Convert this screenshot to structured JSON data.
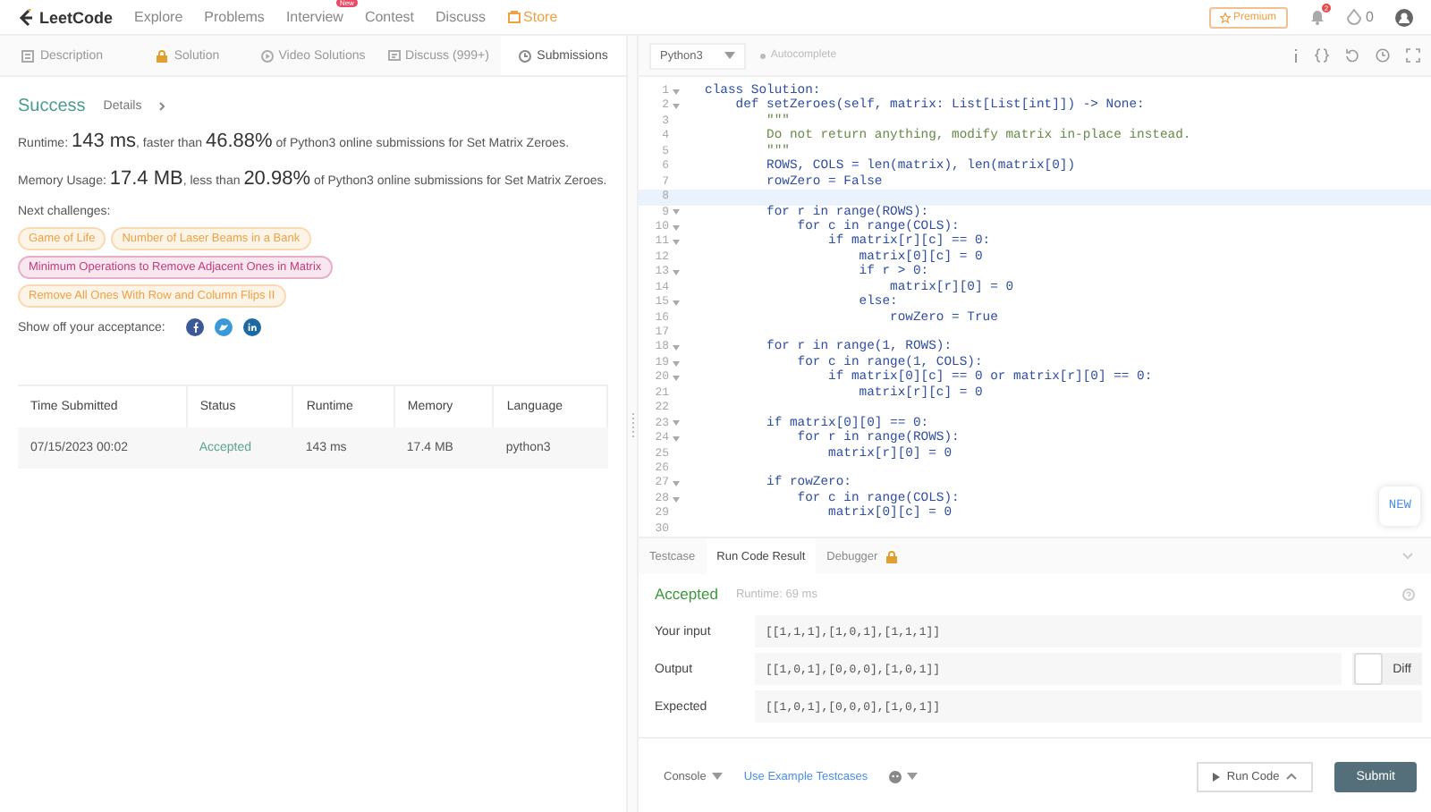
{
  "nav": {
    "brand": "LeetCode",
    "links": [
      {
        "label": "Explore"
      },
      {
        "label": "Problems"
      },
      {
        "label": "Interview",
        "badge": "New"
      },
      {
        "label": "Contest"
      },
      {
        "label": "Discuss"
      }
    ],
    "store": "Store",
    "premium": "Premium",
    "notifications": "2",
    "coins": "0"
  },
  "tabs": [
    {
      "label": "Description",
      "selected": false
    },
    {
      "label": "Solution",
      "selected": false
    },
    {
      "label": "Video Solutions",
      "selected": false
    },
    {
      "label": "Discuss (999+)",
      "selected": false
    },
    {
      "label": "Submissions",
      "selected": true
    }
  ],
  "result": {
    "status": "Success",
    "details": "Details",
    "runtime_line": "Runtime: **143 ms**, faster than **46.88%** of Python3 online submissions for Set Matrix Zeroes.",
    "memory_line": "Memory Usage: **17.4 MB**, less than **20.98%** of Python3 online submissions for Set Matrix Zeroes.",
    "next_label": "Next challenges:",
    "challenges": [
      {
        "label": "Game of Life",
        "color": "#f0a143"
      },
      {
        "label": "Number of Laser Beams in a Bank",
        "color": "#f0a143"
      },
      {
        "label": "Minimum Operations to Remove Adjacent Ones in Matrix",
        "color": "#c43b7c"
      },
      {
        "label": "Remove All Ones With Row and Column Flips II",
        "color": "#f0a143"
      }
    ],
    "share_label": "Show off your acceptance:"
  },
  "table": {
    "columns": [
      "Time Submitted",
      "Status",
      "Runtime",
      "Memory",
      "Language"
    ],
    "rows": [
      [
        "07/15/2023 00:02",
        "Accepted",
        "143 ms",
        "17.4 MB",
        "python3"
      ]
    ]
  },
  "editor": {
    "language": "Python3",
    "autocomplete": "Autocomplete",
    "lines": [
      {
        "num": "1",
        "text": "class Solution:",
        "kind": "code",
        "fold": true,
        "current": false
      },
      {
        "num": "2",
        "text": "    def setZeroes(self, matrix: List[List[int]]) -> None:",
        "kind": "code",
        "fold": true,
        "current": false
      },
      {
        "num": "3",
        "text": "        \"\"\"",
        "kind": "comment",
        "fold": false,
        "current": false
      },
      {
        "num": "4",
        "text": "        Do not return anything, modify matrix in-place instead.",
        "kind": "comment",
        "fold": false,
        "current": false
      },
      {
        "num": "5",
        "text": "        \"\"\"",
        "kind": "comment",
        "fold": false,
        "current": false
      },
      {
        "num": "6",
        "text": "        ROWS, COLS = len(matrix), len(matrix[0])",
        "kind": "code",
        "fold": false,
        "current": false
      },
      {
        "num": "7",
        "text": "        rowZero = False",
        "kind": "code",
        "fold": false,
        "current": false
      },
      {
        "num": "8",
        "fold": false,
        "current": true
      },
      {
        "num": "9",
        "text": "        for r in range(ROWS):",
        "kind": "code",
        "fold": true,
        "current": false
      },
      {
        "num": "10",
        "text": "            for c in range(COLS):",
        "kind": "code",
        "fold": true,
        "current": false
      },
      {
        "num": "11",
        "text": "                if matrix[r][c] == 0:",
        "kind": "code",
        "fold": true,
        "current": false
      },
      {
        "num": "12",
        "text": "                    matrix[0][c] = 0",
        "kind": "code",
        "fold": false,
        "current": false
      },
      {
        "num": "13",
        "text": "                    if r > 0:",
        "kind": "code",
        "fold": true,
        "current": false
      },
      {
        "num": "14",
        "text": "                        matrix[r][0] = 0",
        "kind": "code",
        "fold": false,
        "current": false
      },
      {
        "num": "15",
        "text": "                    else:",
        "kind": "code",
        "fold": true,
        "current": false
      },
      {
        "num": "16",
        "text": "                        rowZero = True",
        "kind": "code",
        "fold": false,
        "current": false
      },
      {
        "num": "17",
        "fold": false,
        "current": false
      },
      {
        "num": "18",
        "text": "        for r in range(1, ROWS):",
        "kind": "code",
        "fold": true,
        "current": false
      },
      {
        "num": "19",
        "text": "            for c in range(1, COLS):",
        "kind": "code",
        "fold": true,
        "current": false
      },
      {
        "num": "20",
        "text": "                if matrix[0][c] == 0 or matrix[r][0] == 0:",
        "kind": "code",
        "fold": true,
        "current": false
      },
      {
        "num": "21",
        "text": "                    matrix[r][c] = 0",
        "kind": "code",
        "fold": false,
        "current": false
      },
      {
        "num": "22",
        "fold": false,
        "current": false
      },
      {
        "num": "23",
        "text": "        if matrix[0][0] == 0:",
        "kind": "code",
        "fold": true,
        "current": false
      },
      {
        "num": "24",
        "text": "            for r in range(ROWS):",
        "kind": "code",
        "fold": true,
        "current": false
      },
      {
        "num": "25",
        "text": "                matrix[r][0] = 0",
        "kind": "code",
        "fold": false,
        "current": false
      },
      {
        "num": "26",
        "fold": false,
        "current": false
      },
      {
        "num": "27",
        "text": "        if rowZero:",
        "kind": "code",
        "fold": true,
        "current": false
      },
      {
        "num": "28",
        "text": "            for c in range(COLS):",
        "kind": "code",
        "fold": true,
        "current": false
      },
      {
        "num": "29",
        "text": "                matrix[0][c] = 0",
        "kind": "code",
        "fold": false,
        "current": false
      },
      {
        "num": "30",
        "fold": false,
        "current": false
      }
    ],
    "new_button": "NEW"
  },
  "console": {
    "tabs": [
      {
        "label": "Testcase",
        "selected": false,
        "locked": false
      },
      {
        "label": "Run Code Result",
        "selected": true,
        "locked": false
      },
      {
        "label": "Debugger",
        "selected": false,
        "locked": true
      }
    ],
    "status": "Accepted",
    "runtime": "Runtime: 69 ms",
    "rows": [
      {
        "label": "Your input",
        "value": "[[1,1,1],[1,0,1],[1,1,1]]",
        "diff": false
      },
      {
        "label": "Output",
        "value": "[[1,0,1],[0,0,0],[1,0,1]]",
        "diff": true
      },
      {
        "label": "Expected",
        "value": "[[1,0,1],[0,0,0],[1,0,1]]",
        "diff": false
      }
    ],
    "diff_label": "Diff",
    "diff_on": false,
    "console_button": "Console",
    "example_link": "Use Example Testcases",
    "run_button": "Run Code",
    "submit_button": "Submit"
  }
}
